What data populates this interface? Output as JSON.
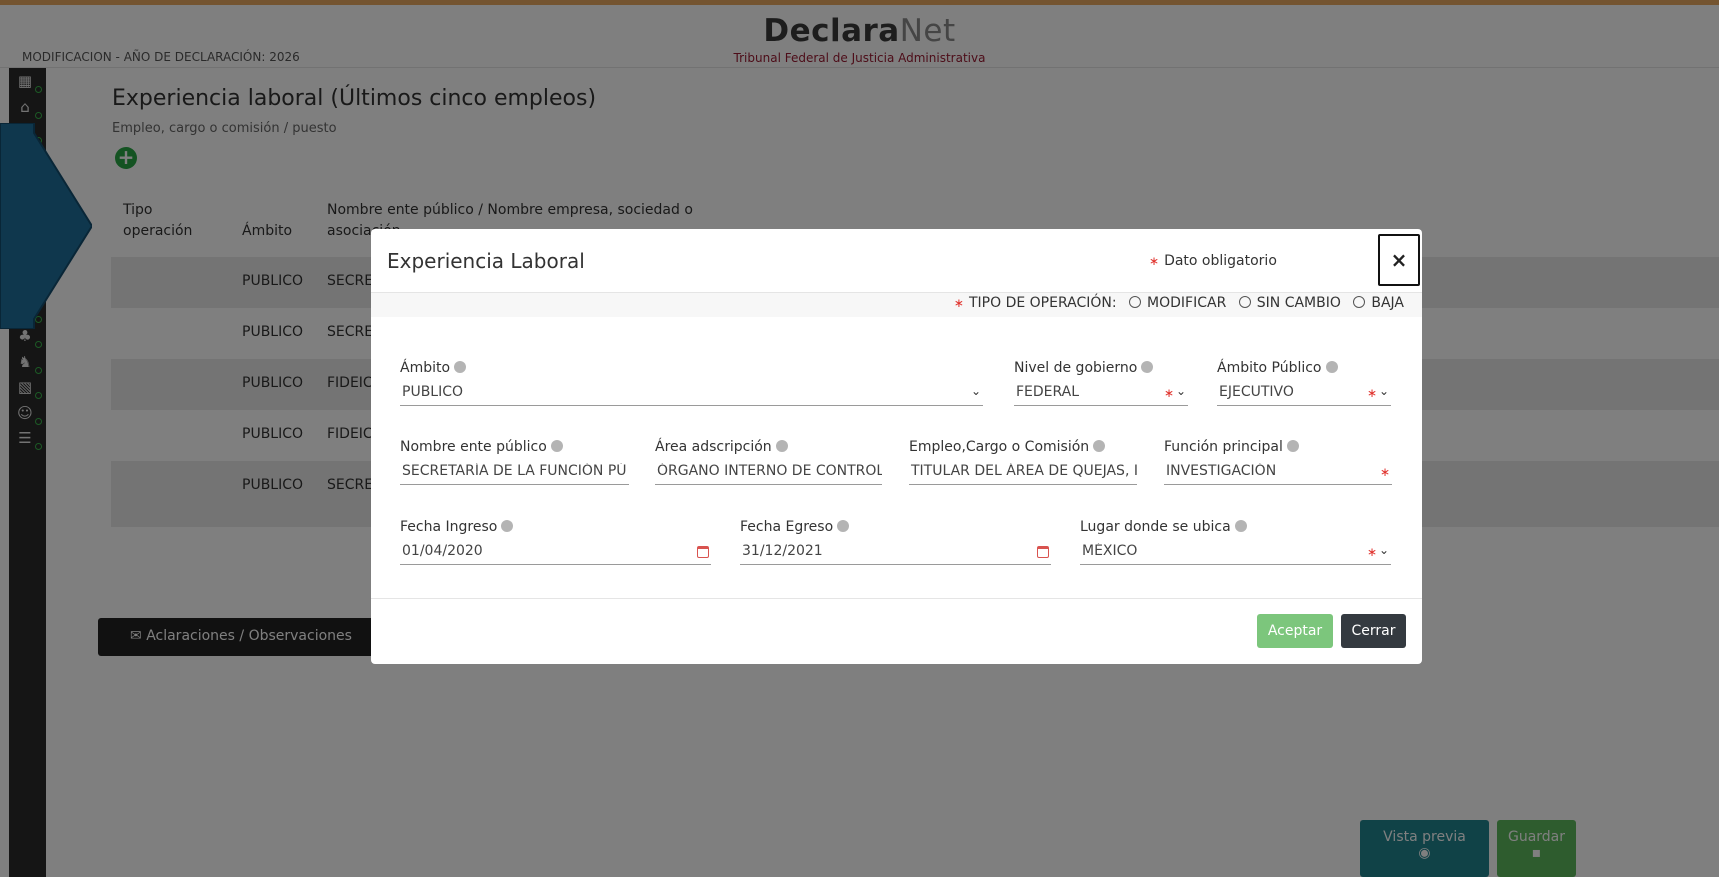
{
  "header": {
    "brand_bold": "Declara",
    "brand_light": "Net",
    "subtitle": "Tribunal Federal de Justicia Administrativa",
    "declaration_meta": "MODIFICACION - AÑO DE DECLARACIÓN: 2026"
  },
  "sidebar": {
    "icons": [
      {
        "name": "form-icon",
        "glyph": "▦",
        "status": "complete"
      },
      {
        "name": "home-icon",
        "glyph": "⌂",
        "status": "complete"
      },
      {
        "name": "document-icon",
        "glyph": "▤",
        "status": "complete"
      },
      {
        "name": "car-icon",
        "glyph": "◫",
        "status": "incomplete"
      },
      {
        "name": "chart-icon",
        "glyph": "↗",
        "status": "incomplete"
      },
      {
        "name": "hands-icon",
        "glyph": "✋",
        "status": "incomplete"
      },
      {
        "name": "bus-icon",
        "glyph": "▣",
        "status": "incomplete"
      },
      {
        "name": "house-icon",
        "glyph": "⌂",
        "status": "complete"
      },
      {
        "name": "pie-chart-icon",
        "glyph": "◔",
        "status": "complete"
      },
      {
        "name": "people-icon",
        "glyph": "♟",
        "status": "complete"
      },
      {
        "name": "group-icon",
        "glyph": "♣",
        "status": "complete"
      },
      {
        "name": "team-icon",
        "glyph": "♞",
        "status": "complete"
      },
      {
        "name": "board-icon",
        "glyph": "▧",
        "status": "complete"
      },
      {
        "name": "user-icon",
        "glyph": "☺",
        "status": "complete"
      },
      {
        "name": "checklist-icon",
        "glyph": "☰",
        "status": "complete"
      }
    ],
    "colors": {
      "complete": "#39b54a",
      "incomplete": "#d9534f"
    }
  },
  "section": {
    "title": "Experiencia laboral (Últimos cinco empleos)",
    "subtitle": "Empleo, cargo o comisión / puesto",
    "add_icon": "plus-circle-icon"
  },
  "table": {
    "headers": {
      "tipo": "Tipo\noperación",
      "ambito": "Ámbito",
      "nombre": "Nombre ente público / Nombre empresa, sociedad o\nasociación"
    },
    "rows": [
      {
        "ambito": "PUBLICO",
        "nombre": "SECRE"
      },
      {
        "ambito": "PUBLICO",
        "nombre": "SECRE"
      },
      {
        "ambito": "PUBLICO",
        "nombre": "FIDEIC"
      },
      {
        "ambito": "PUBLICO",
        "nombre": "FIDEIC"
      },
      {
        "ambito": "PUBLICO",
        "nombre": "SECRE"
      }
    ]
  },
  "aclaraciones_label": "Aclaraciones / Observaciones",
  "bottom_buttons": {
    "preview": "Vista previa",
    "save": "Guardar"
  },
  "modal": {
    "title": "Experiencia Laboral",
    "required_note": "Dato obligatorio",
    "close_symbol": "×",
    "operation_label": "TIPO DE OPERACIÓN:",
    "operation_options": [
      "MODIFICAR",
      "SIN CAMBIO",
      "BAJA"
    ],
    "fields": {
      "ambito": {
        "label": "Ámbito",
        "value": "PUBLICO"
      },
      "nivel_gobierno": {
        "label": "Nivel de gobierno",
        "value": "FEDERAL"
      },
      "ambito_publico": {
        "label": "Ámbito Público",
        "value": "EJECUTIVO"
      },
      "nombre_ente": {
        "label": "Nombre ente público",
        "value": "SECRETARÍA DE LA FUNCIÓN PÚ"
      },
      "area_adscripcion": {
        "label": "Área adscripción",
        "value": "ÓRGANO INTERNO DE CONTROL"
      },
      "empleo_cargo": {
        "label": "Empleo,Cargo o Comisión",
        "value": "TITULAR DEL ÁREA DE QUEJAS, I"
      },
      "funcion_principal": {
        "label": "Función principal",
        "value": "INVESTIGACIÓN"
      },
      "fecha_ingreso": {
        "label": "Fecha Ingreso",
        "value": "01/04/2020"
      },
      "fecha_egreso": {
        "label": "Fecha Egreso",
        "value": "31/12/2021"
      },
      "lugar": {
        "label": "Lugar donde se ubica",
        "value": "MÉXICO"
      }
    },
    "buttons": {
      "accept": "Aceptar",
      "close": "Cerrar"
    }
  },
  "colors": {
    "accent_teal": "#20848f",
    "success_green": "#5cb85c",
    "required_red": "#e0302b",
    "brand_red": "#9a1b32"
  }
}
